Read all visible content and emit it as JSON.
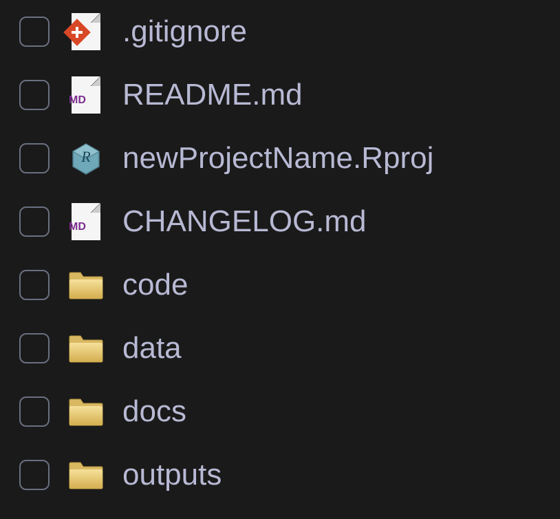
{
  "files": [
    {
      "name": ".gitignore",
      "icon": "git",
      "type": "file"
    },
    {
      "name": "README.md",
      "icon": "md",
      "type": "file"
    },
    {
      "name": "newProjectName.Rproj",
      "icon": "rproj",
      "type": "file"
    },
    {
      "name": "CHANGELOG.md",
      "icon": "md",
      "type": "file"
    },
    {
      "name": "code",
      "icon": "folder",
      "type": "folder"
    },
    {
      "name": "data",
      "icon": "folder",
      "type": "folder"
    },
    {
      "name": "docs",
      "icon": "folder",
      "type": "folder"
    },
    {
      "name": "outputs",
      "icon": "folder",
      "type": "folder"
    }
  ]
}
